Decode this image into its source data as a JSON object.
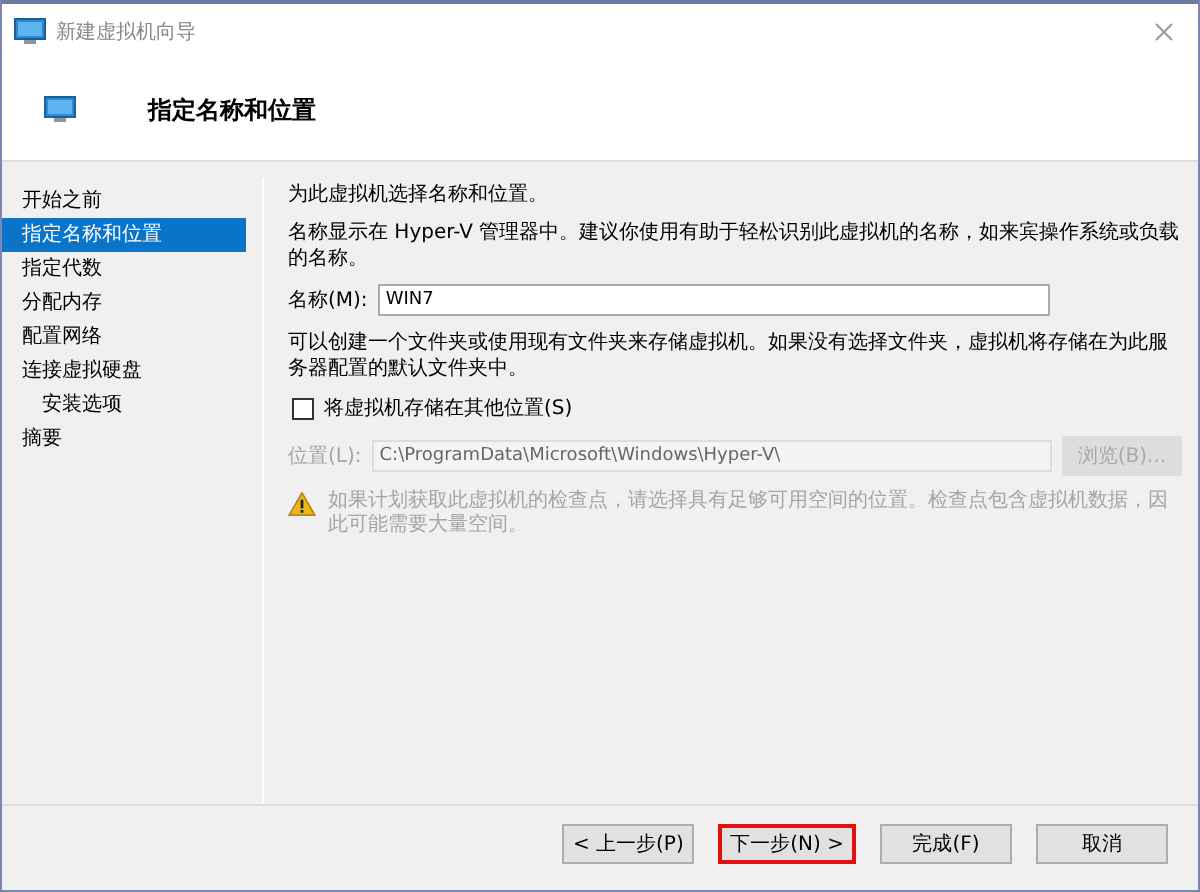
{
  "window": {
    "title": "新建虚拟机向导"
  },
  "header": {
    "title": "指定名称和位置"
  },
  "sidebar": {
    "items": [
      {
        "label": "开始之前",
        "selected": false
      },
      {
        "label": "指定名称和位置",
        "selected": true
      },
      {
        "label": "指定代数",
        "selected": false
      },
      {
        "label": "分配内存",
        "selected": false
      },
      {
        "label": "配置网络",
        "selected": false
      },
      {
        "label": "连接虚拟硬盘",
        "selected": false,
        "children": [
          {
            "label": "安装选项",
            "selected": false
          }
        ]
      },
      {
        "label": "摘要",
        "selected": false
      }
    ]
  },
  "content": {
    "intro": "为此虚拟机选择名称和位置。",
    "name_hint": "名称显示在 Hyper-V 管理器中。建议你使用有助于轻松识别此虚拟机的名称，如来宾操作系统或负载的名称。",
    "name_field": {
      "label": "名称(M):",
      "value": "WIN7"
    },
    "folder_hint": "可以创建一个文件夹或使用现有文件夹来存储虚拟机。如果没有选择文件夹，虚拟机将存储在为此服务器配置的默认文件夹中。",
    "store_elsewhere": {
      "label": "将虚拟机存储在其他位置(S)",
      "checked": false
    },
    "location_field": {
      "label": "位置(L):",
      "value": "C:\\ProgramData\\Microsoft\\Windows\\Hyper-V\\",
      "disabled": true
    },
    "browse_button": {
      "label": "浏览(B)...",
      "disabled": true
    },
    "warning": {
      "text": "如果计划获取此虚拟机的检查点，请选择具有足够可用空间的位置。检查点包含虚拟机数据，因此可能需要大量空间。",
      "disabled": true
    }
  },
  "buttons": [
    {
      "label": "< 上一步(P)",
      "highlighted": false
    },
    {
      "label": "下一步(N) >",
      "highlighted": true
    },
    {
      "label": "完成(F)",
      "highlighted": false
    },
    {
      "label": "取消",
      "highlighted": false
    }
  ]
}
